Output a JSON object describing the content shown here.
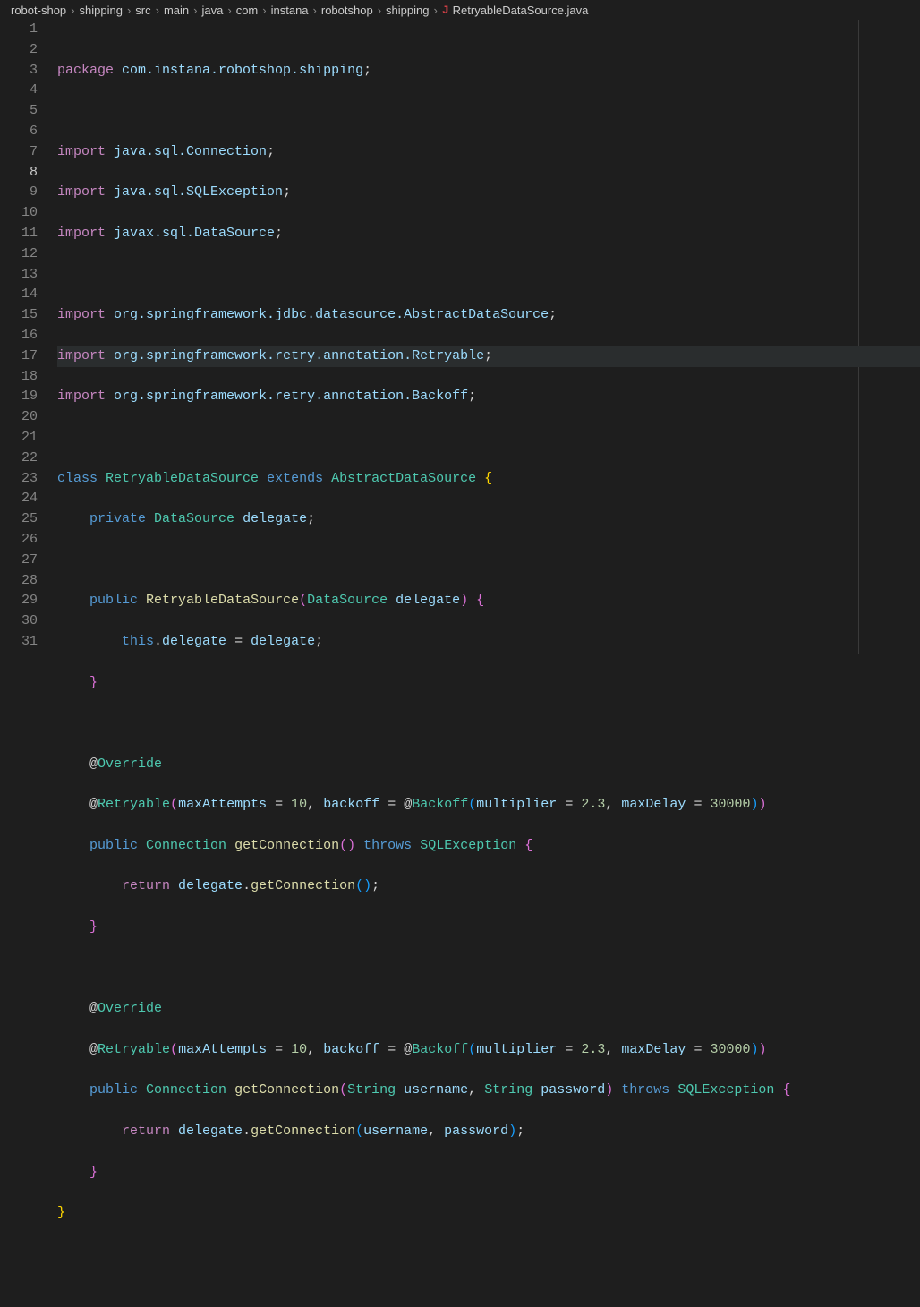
{
  "breadcrumb": {
    "items": [
      "robot-shop",
      "shipping",
      "src",
      "main",
      "java",
      "com",
      "instana",
      "robotshop",
      "shipping"
    ],
    "file": "RetryableDataSource.java",
    "file_icon_label": "J"
  },
  "editor": {
    "active_line": 8,
    "line_count": 31,
    "tokens": {
      "package": "package",
      "import": "import",
      "class": "class",
      "extends": "extends",
      "private": "private",
      "public": "public",
      "this": "this",
      "return": "return",
      "throws": "throws",
      "pkg_path": "com.instana.robotshop.shipping",
      "imp_conn": "java.sql.Connection",
      "imp_sqlex": "java.sql.SQLException",
      "imp_ds": "javax.sql.DataSource",
      "imp_ads": "org.springframework.jdbc.datasource.AbstractDataSource",
      "imp_retry": "org.springframework.retry.annotation.Retryable",
      "imp_backoff": "org.springframework.retry.annotation.Backoff",
      "cls_name": "RetryableDataSource",
      "ext_name": "AbstractDataSource",
      "ty_ds": "DataSource",
      "ty_conn": "Connection",
      "ty_sqlex": "SQLException",
      "ty_string": "String",
      "fld_delegate": "delegate",
      "ann_override": "Override",
      "ann_retry": "Retryable",
      "ann_backoff": "Backoff",
      "p_maxAttempts": "maxAttempts",
      "p_backoff": "backoff",
      "p_multiplier": "multiplier",
      "p_maxDelay": "maxDelay",
      "p_username": "username",
      "p_password": "password",
      "n_10": "10",
      "n_2_3": "2.3",
      "n_30000": "30000",
      "m_getConn": "getConnection"
    }
  }
}
